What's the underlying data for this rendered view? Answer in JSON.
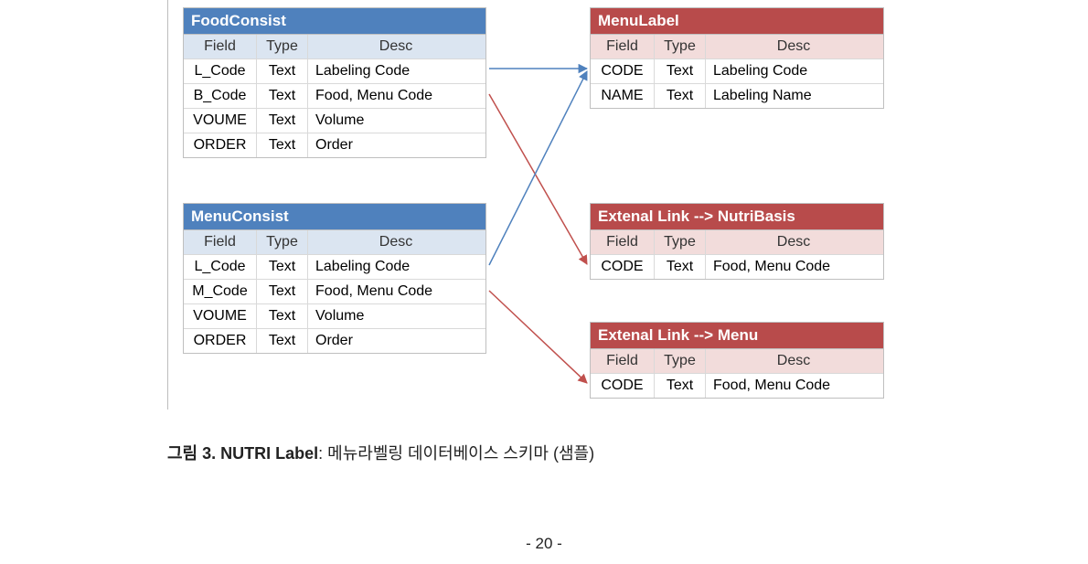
{
  "headers": {
    "field": "Field",
    "type": "Type",
    "desc": "Desc"
  },
  "tables": {
    "foodConsist": {
      "title": "FoodConsist",
      "rows": [
        {
          "field": "L_Code",
          "type": "Text",
          "desc": "Labeling Code"
        },
        {
          "field": "B_Code",
          "type": "Text",
          "desc": "Food, Menu Code"
        },
        {
          "field": "VOUME",
          "type": "Text",
          "desc": "Volume"
        },
        {
          "field": "ORDER",
          "type": "Text",
          "desc": "Order"
        }
      ]
    },
    "menuConsist": {
      "title": "MenuConsist",
      "rows": [
        {
          "field": "L_Code",
          "type": "Text",
          "desc": "Labeling Code"
        },
        {
          "field": "M_Code",
          "type": "Text",
          "desc": "Food, Menu Code"
        },
        {
          "field": "VOUME",
          "type": "Text",
          "desc": "Volume"
        },
        {
          "field": "ORDER",
          "type": "Text",
          "desc": "Order"
        }
      ]
    },
    "menuLabel": {
      "title": "MenuLabel",
      "rows": [
        {
          "field": "CODE",
          "type": "Text",
          "desc": "Labeling Code"
        },
        {
          "field": "NAME",
          "type": "Text",
          "desc": "Labeling Name"
        }
      ]
    },
    "extNutriBasis": {
      "title": "Extenal Link --> NutriBasis",
      "rows": [
        {
          "field": "CODE",
          "type": "Text",
          "desc": "Food, Menu Code"
        }
      ]
    },
    "extMenu": {
      "title": "Extenal Link --> Menu",
      "rows": [
        {
          "field": "CODE",
          "type": "Text",
          "desc": "Food, Menu Code"
        }
      ]
    }
  },
  "caption": {
    "prefix": "그림 3. NUTRI Label",
    "rest": ": 메뉴라벨링 데이터베이스 스키마 (샘플)"
  },
  "pageNumber": "- 20 -",
  "arrowColors": {
    "blue": "#4f81bd",
    "red": "#c0504d"
  }
}
